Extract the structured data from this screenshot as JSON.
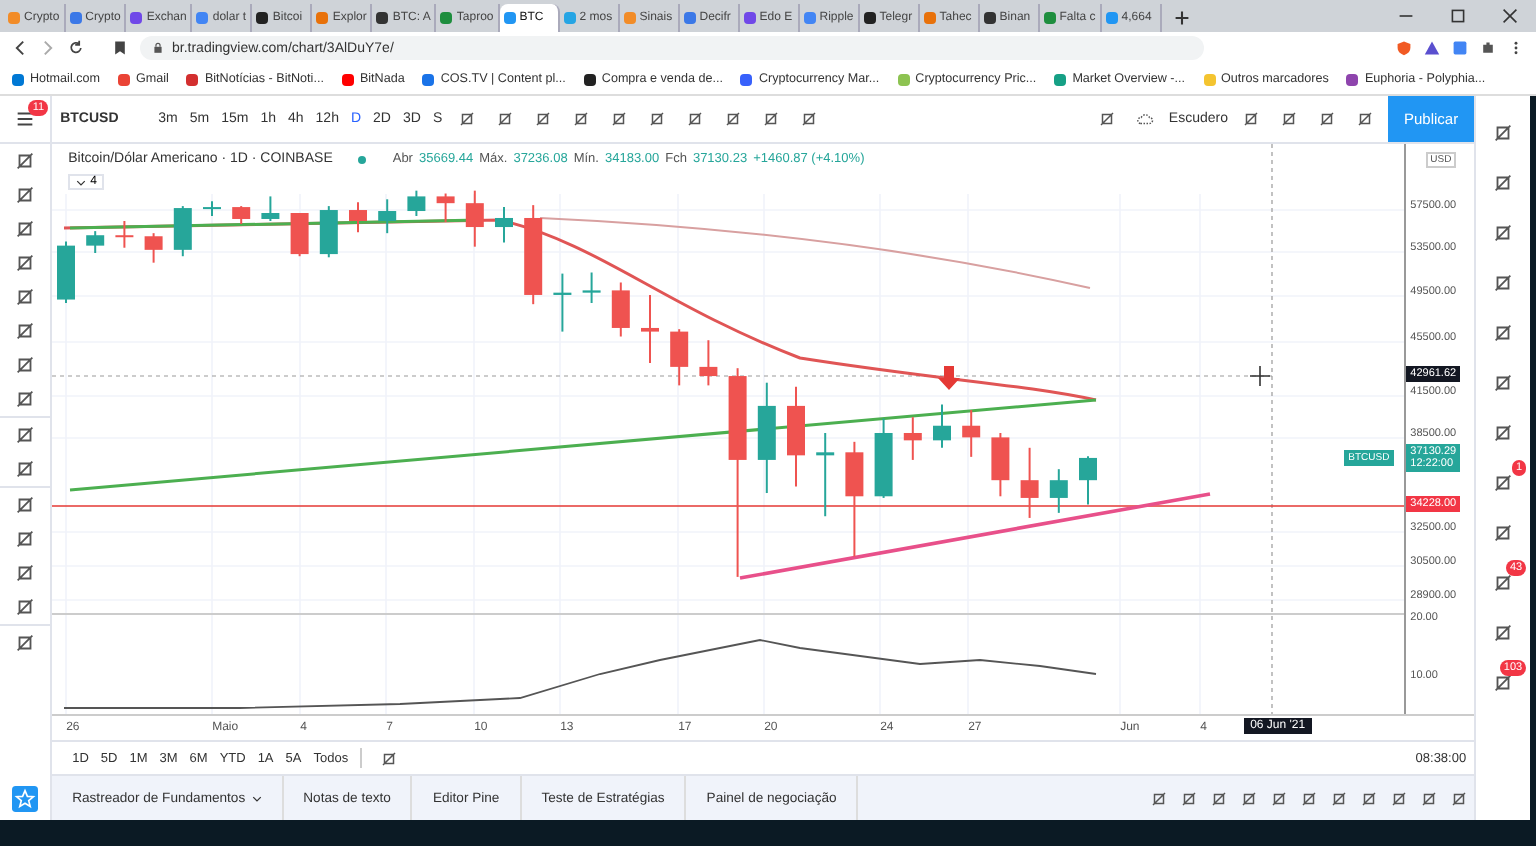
{
  "browser": {
    "tabs": [
      {
        "title": "Crypto",
        "selected": false
      },
      {
        "title": "Crypto",
        "selected": false
      },
      {
        "title": "Exchan",
        "selected": false
      },
      {
        "title": "dolar t",
        "selected": false
      },
      {
        "title": "Bitcoi",
        "selected": false
      },
      {
        "title": "Explor",
        "selected": false
      },
      {
        "title": "BTC: A",
        "selected": false
      },
      {
        "title": "Taproo",
        "selected": false
      },
      {
        "title": "BTC",
        "selected": true
      },
      {
        "title": "2 mos",
        "selected": false
      },
      {
        "title": "Sinais",
        "selected": false
      },
      {
        "title": "Decifr",
        "selected": false
      },
      {
        "title": "Edo E",
        "selected": false
      },
      {
        "title": "Ripple",
        "selected": false
      },
      {
        "title": "Telegr",
        "selected": false
      },
      {
        "title": "Tahec",
        "selected": false
      },
      {
        "title": "Binan",
        "selected": false
      },
      {
        "title": "Falta c",
        "selected": false
      },
      {
        "title": "4,664",
        "selected": false
      }
    ],
    "url": "br.tradingview.com/chart/3AlDuY7e/",
    "bookmarks": [
      "Hotmail.com",
      "Gmail",
      "BitNotícias - BitNoti...",
      "BitNada",
      "COS.TV | Content pl...",
      "Compra e venda de...",
      "Cryptocurrency Mar...",
      "Cryptocurrency Pric...",
      "Market Overview -...",
      "Outros marcadores",
      "Euphoria - Polyphia..."
    ]
  },
  "toolbar": {
    "menu_badge": "11",
    "symbol": "BTCUSD",
    "intervals": [
      {
        "label": "3m",
        "selected": false
      },
      {
        "label": "5m",
        "selected": false
      },
      {
        "label": "15m",
        "selected": false
      },
      {
        "label": "1h",
        "selected": false
      },
      {
        "label": "4h",
        "selected": false
      },
      {
        "label": "12h",
        "selected": false
      },
      {
        "label": "D",
        "selected": true
      },
      {
        "label": "2D",
        "selected": false
      },
      {
        "label": "3D",
        "selected": false
      },
      {
        "label": "S",
        "selected": false
      }
    ],
    "layout_name": "Escudero",
    "publish": "Publicar"
  },
  "legend": {
    "title": "Bitcoin/Dólar Americano · 1D · COINBASE",
    "values": [
      {
        "label": "Abr",
        "value": "35669.44"
      },
      {
        "label": "Máx.",
        "value": "37236.08"
      },
      {
        "label": "Mín.",
        "value": "34183.00"
      },
      {
        "label": "Fch",
        "value": "37130.23"
      }
    ],
    "change": "+1460.87 (+4.10%)",
    "indicator_count": "4"
  },
  "price_axis": {
    "currency": "USD",
    "ticks": [
      "57500.00",
      "53500.00",
      "49500.00",
      "45500.00",
      "41500.00",
      "38500.00",
      "32500.00",
      "30500.00",
      "28900.00"
    ],
    "crosshair_price": "42961.62",
    "last_symbol": "BTCUSD",
    "last_price": "37130.29",
    "countdown": "12:22:00",
    "line_price": "34228.00",
    "indicator_ticks": [
      "20.00",
      "10.00"
    ]
  },
  "time_axis": {
    "ticks": [
      "26",
      "Maio",
      "4",
      "7",
      "10",
      "13",
      "17",
      "20",
      "24",
      "27",
      "Jun",
      "4"
    ],
    "crosshair_date": "06 Jun '21"
  },
  "ranges": [
    "1D",
    "5D",
    "1M",
    "3M",
    "6M",
    "YTD",
    "1A",
    "5A",
    "Todos"
  ],
  "clock": "08:38:00",
  "bottom_tabs": [
    "Rastreador de Fundamentos",
    "Notas de texto",
    "Editor Pine",
    "Teste de Estratégias",
    "Painel de negociação"
  ],
  "sidebar_badges": [
    "1",
    "43",
    "103"
  ]
}
